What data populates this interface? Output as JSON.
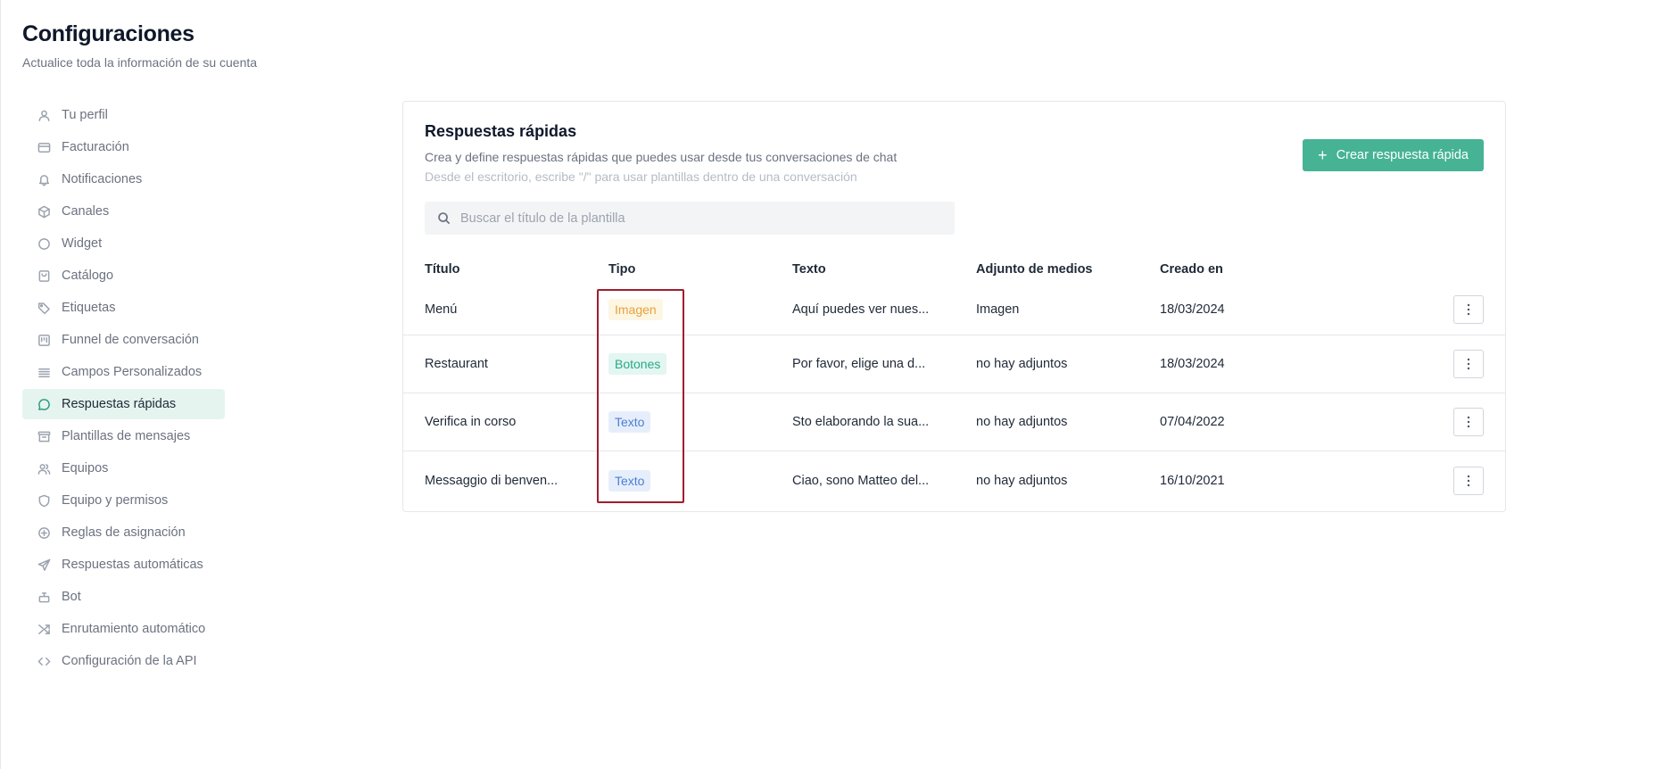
{
  "page": {
    "title": "Configuraciones",
    "subtitle": "Actualice toda la información de su cuenta"
  },
  "sidebar": {
    "items": [
      {
        "label": "Tu perfil",
        "icon": "user-icon"
      },
      {
        "label": "Facturación",
        "icon": "credit-card-icon"
      },
      {
        "label": "Notificaciones",
        "icon": "bell-icon"
      },
      {
        "label": "Canales",
        "icon": "cube-icon"
      },
      {
        "label": "Widget",
        "icon": "circle-icon"
      },
      {
        "label": "Catálogo",
        "icon": "shopping-bag-icon"
      },
      {
        "label": "Etiquetas",
        "icon": "tag-icon"
      },
      {
        "label": "Funnel de conversación",
        "icon": "kanban-icon"
      },
      {
        "label": "Campos Personalizados",
        "icon": "list-icon"
      },
      {
        "label": "Respuestas rápidas",
        "icon": "chat-bubble-icon",
        "active": true
      },
      {
        "label": "Plantillas de mensajes",
        "icon": "archive-icon"
      },
      {
        "label": "Equipos",
        "icon": "users-icon"
      },
      {
        "label": "Equipo y permisos",
        "icon": "shield-icon"
      },
      {
        "label": "Reglas de asignación",
        "icon": "plus-circle-icon"
      },
      {
        "label": "Respuestas automáticas",
        "icon": "send-icon"
      },
      {
        "label": "Bot",
        "icon": "bot-icon"
      },
      {
        "label": "Enrutamiento automático",
        "icon": "shuffle-icon"
      },
      {
        "label": "Configuración de la API",
        "icon": "code-icon"
      }
    ]
  },
  "card": {
    "title": "Respuestas rápidas",
    "description": "Crea y define respuestas rápidas que puedes usar desde tus conversaciones de chat",
    "hint": "Desde el escritorio, escribe \"/\" para usar plantillas dentro de una conversación",
    "create_button": "Crear respuesta rápida",
    "search_placeholder": "Buscar el título de la plantilla"
  },
  "table": {
    "headers": {
      "title": "Título",
      "type": "Tipo",
      "text": "Texto",
      "media": "Adjunto de medios",
      "created": "Creado en"
    },
    "rows": [
      {
        "title": "Menú",
        "type": "Imagen",
        "text": "Aquí puedes ver nues...",
        "media": "Imagen",
        "created": "18/03/2024"
      },
      {
        "title": "Restaurant",
        "type": "Botones",
        "text": "Por favor, elige una d...",
        "media": "no hay adjuntos",
        "created": "18/03/2024"
      },
      {
        "title": "Verifica in corso",
        "type": "Texto",
        "text": "Sto elaborando la sua...",
        "media": "no hay adjuntos",
        "created": "07/04/2022"
      },
      {
        "title": "Messaggio di benven...",
        "type": "Texto",
        "text": "Ciao, sono Matteo del...",
        "media": "no hay adjuntos",
        "created": "16/10/2021"
      }
    ]
  },
  "colors": {
    "accent": "#46b394",
    "active_bg": "#e6f4f0",
    "highlight_border": "#a01d2e"
  }
}
